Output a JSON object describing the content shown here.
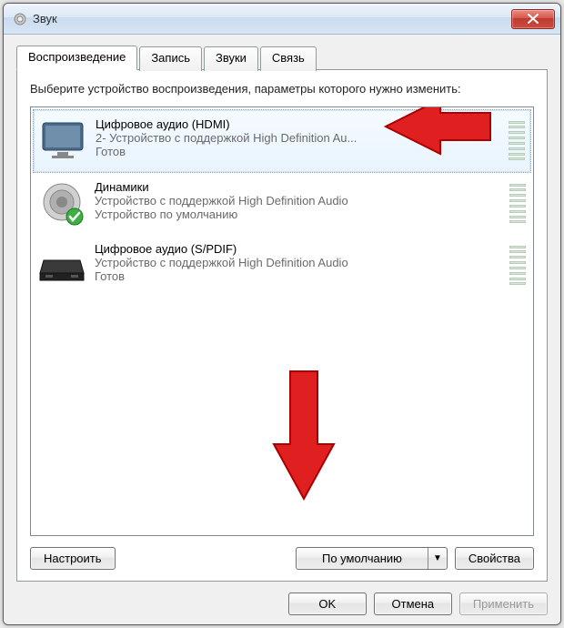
{
  "window": {
    "title": "Звук"
  },
  "tabs": {
    "playback": "Воспроизведение",
    "recording": "Запись",
    "sounds": "Звуки",
    "communications": "Связь"
  },
  "instruction": "Выберите устройство воспроизведения, параметры которого нужно изменить:",
  "devices": [
    {
      "title": "Цифровое аудио (HDMI)",
      "subtitle": "2- Устройство с поддержкой High Definition Au...",
      "status": "Готов"
    },
    {
      "title": "Динамики",
      "subtitle": "Устройство с поддержкой High Definition Audio",
      "status": "Устройство по умолчанию"
    },
    {
      "title": "Цифровое аудио (S/PDIF)",
      "subtitle": "Устройство с поддержкой High Definition Audio",
      "status": "Готов"
    }
  ],
  "buttons": {
    "configure": "Настроить",
    "set_default": "По умолчанию",
    "properties": "Свойства",
    "ok": "OK",
    "cancel": "Отмена",
    "apply": "Применить"
  }
}
